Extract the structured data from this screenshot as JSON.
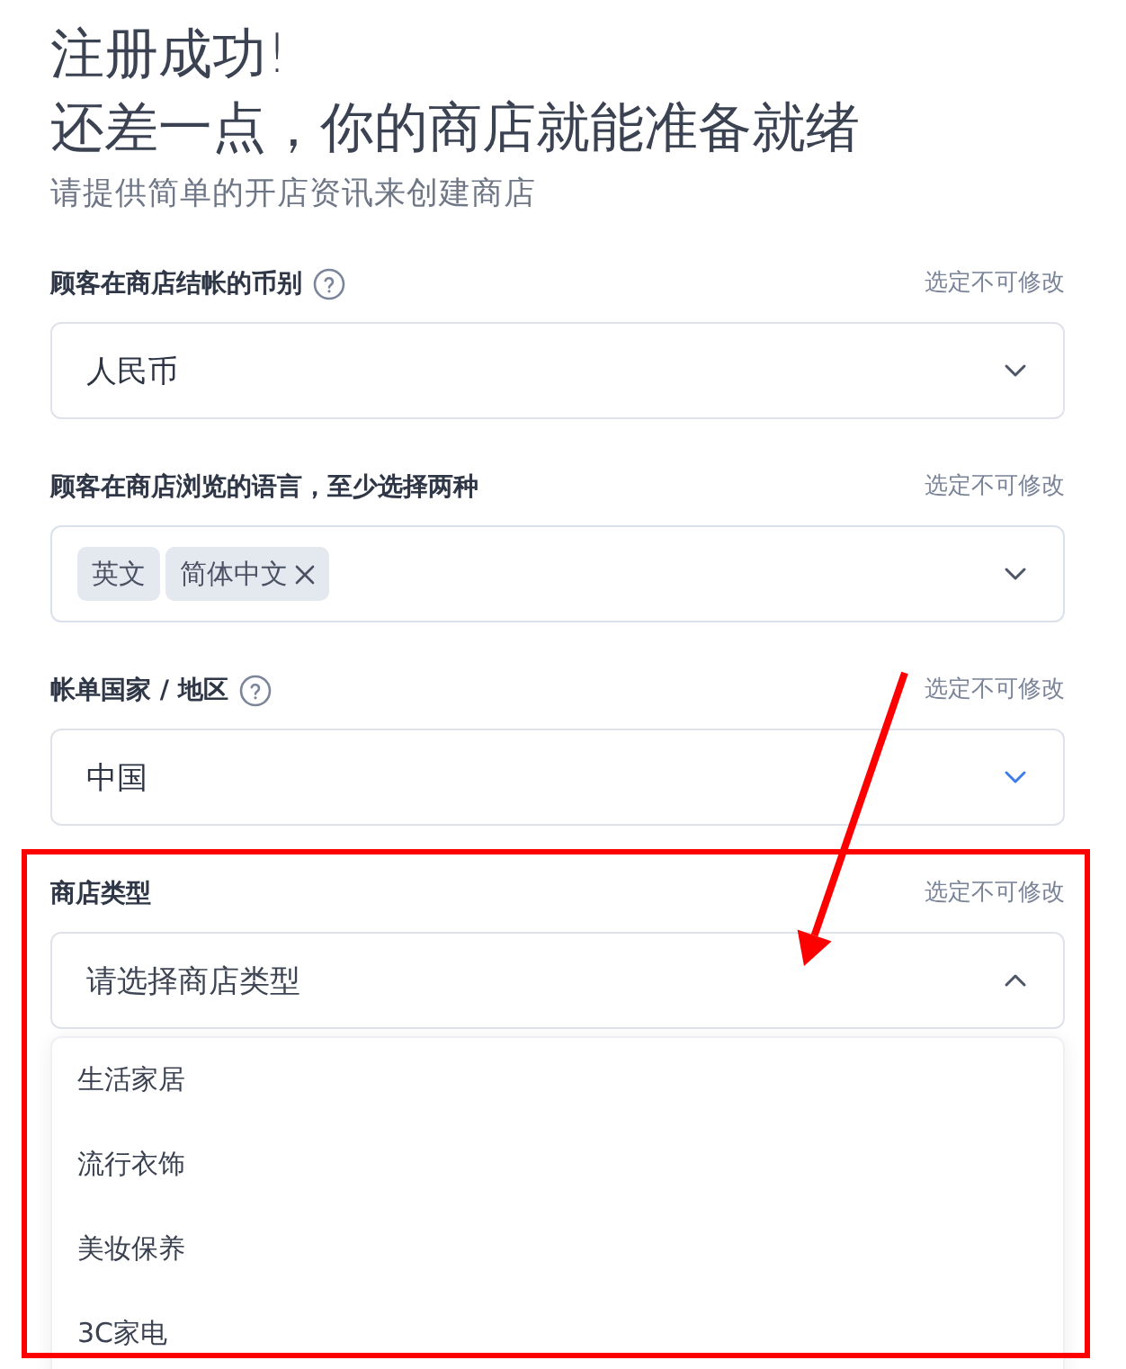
{
  "heading": {
    "title_lines": [
      "注册成功!",
      "还差一点，你的商店就能准备就绪"
    ],
    "subtitle": "请提供简单的开店资讯来创建商店"
  },
  "fields": [
    {
      "kind": "select",
      "label": "顾客在商店结帐的币别",
      "help": true,
      "note": "选定不可修改",
      "value": "人民币",
      "focused": false,
      "expanded": false,
      "highlighted": false
    },
    {
      "kind": "tags",
      "label": "顾客在商店浏览的语言，至少选择两种",
      "help": false,
      "note": "选定不可修改",
      "tags": [
        {
          "label": "英文",
          "removable": false
        },
        {
          "label": "简体中文",
          "removable": true
        }
      ],
      "focused": false,
      "expanded": false,
      "highlighted": false
    },
    {
      "kind": "select",
      "label": "帐单国家 / 地区",
      "help": true,
      "note": "选定不可修改",
      "value": "中国",
      "focused": true,
      "expanded": false,
      "highlighted": false
    },
    {
      "kind": "select",
      "label": "商店类型",
      "help": false,
      "note": "选定不可修改",
      "placeholder": "请选择商店类型",
      "focused": false,
      "expanded": true,
      "highlighted": true,
      "options": [
        {
          "label": "生活家居",
          "selected": false
        },
        {
          "label": "流行衣饰",
          "selected": false
        },
        {
          "label": "美妆保养",
          "selected": false
        },
        {
          "label": "3C家电",
          "selected": false
        }
      ]
    }
  ]
}
